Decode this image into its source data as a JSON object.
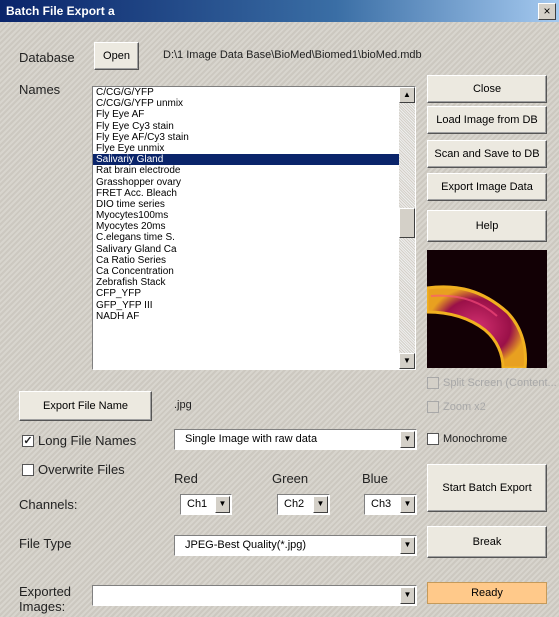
{
  "window": {
    "title": "Batch File Export a",
    "close_glyph": "×"
  },
  "database": {
    "label": "Database",
    "open_label": "Open",
    "path": "D:\\1 Image Data Base\\BioMed\\Biomed1\\bioMed.mdb"
  },
  "names": {
    "label": "Names",
    "items": [
      {
        "label": "C/CG/G/YFP",
        "selected": false
      },
      {
        "label": "C/CG/G/YFP unmix",
        "selected": false
      },
      {
        "label": "Fly Eye AF",
        "selected": false
      },
      {
        "label": "Fly Eye Cy3 stain",
        "selected": false
      },
      {
        "label": "Fly Eye AF/Cy3 stain",
        "selected": false
      },
      {
        "label": "Flye Eye unmix",
        "selected": false
      },
      {
        "label": "Salivariy Gland",
        "selected": true
      },
      {
        "label": "Rat brain electrode",
        "selected": false
      },
      {
        "label": "Grasshopper ovary",
        "selected": false
      },
      {
        "label": "FRET Acc. Bleach",
        "selected": false
      },
      {
        "label": "DIO time series",
        "selected": false
      },
      {
        "label": "Myocytes100ms",
        "selected": false
      },
      {
        "label": "Myocytes 20ms",
        "selected": false
      },
      {
        "label": "C.elegans time S.",
        "selected": false
      },
      {
        "label": "Salivary Gland Ca",
        "selected": false
      },
      {
        "label": "Ca Ratio Series",
        "selected": false
      },
      {
        "label": "Ca Concentration",
        "selected": false
      },
      {
        "label": "Zebrafish Stack",
        "selected": false
      },
      {
        "label": "CFP_YFP",
        "selected": false
      },
      {
        "label": "GFP_YFP III",
        "selected": false
      },
      {
        "label": "NADH AF",
        "selected": false
      }
    ]
  },
  "buttons": {
    "close": "Close",
    "load_image": "Load Image from DB",
    "scan_save": "Scan and Save to DB",
    "export_image": "Export Image Data",
    "help": "Help",
    "export_file_name": "Export File Name",
    "start_batch": "Start Batch Export",
    "break": "Break"
  },
  "extension": ".jpg",
  "options": {
    "split_screen": "Split Screen (Content...",
    "zoom": "Zoom x2",
    "long_file_names": "Long File Names",
    "overwrite_files": "Overwrite Files",
    "monochrome": "Monochrome",
    "long_file_names_checked": true,
    "overwrite_files_checked": false,
    "monochrome_checked": false,
    "check_glyph": "✓"
  },
  "image_mode": {
    "value": "Single Image with raw data"
  },
  "channels": {
    "label": "Channels:",
    "red_label": "Red",
    "green_label": "Green",
    "blue_label": "Blue",
    "red_value": "Ch1",
    "green_value": "Ch2",
    "blue_value": "Ch3"
  },
  "file_type": {
    "label": "File Type",
    "value": "JPEG-Best Quality(*.jpg)"
  },
  "exported": {
    "label_line1": "Exported",
    "label_line2": "Images:",
    "value": ""
  },
  "status": {
    "text": "Ready"
  },
  "icons": {
    "dropdown": "dropdown-arrow-icon",
    "scroll_up": "scroll-up-icon",
    "scroll_down": "scroll-down-icon"
  },
  "colors": {
    "selection": "#0a246a",
    "status_bg": "#ffc98a",
    "titlebar": "#0a246a"
  }
}
